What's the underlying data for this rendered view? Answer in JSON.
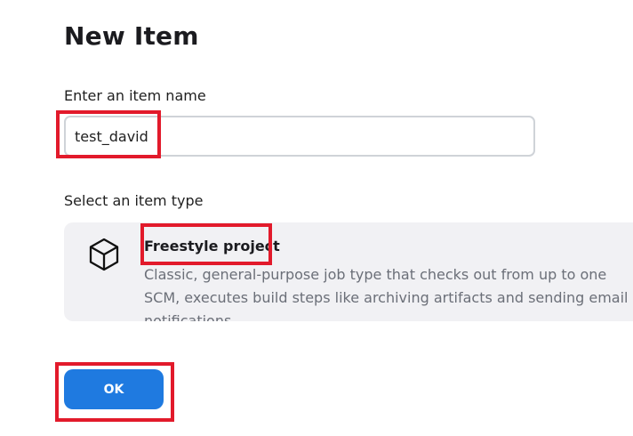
{
  "page": {
    "title": "New Item"
  },
  "item_name": {
    "label": "Enter an item name",
    "value": "test_david"
  },
  "item_type": {
    "label": "Select an item type",
    "options": [
      {
        "title": "Freestyle project",
        "description": "Classic, general-purpose job type that checks out from up to one SCM, executes build steps like archiving artifacts and sending email notifications.",
        "icon": "cube-icon"
      }
    ]
  },
  "actions": {
    "ok_label": "OK"
  },
  "colors": {
    "primary_button": "#1f7ae0",
    "highlight": "#e21a2b",
    "card_background": "#f1f1f4"
  }
}
